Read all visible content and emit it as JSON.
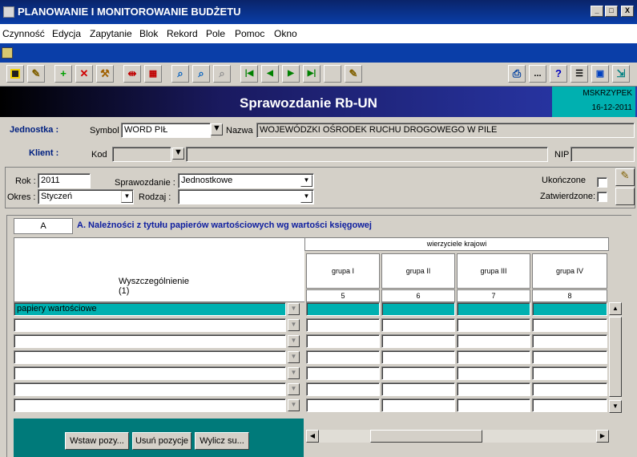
{
  "window": {
    "title": "PLANOWANIE I MONITOROWANIE BUDŻETU"
  },
  "window_buttons": [
    "_",
    "□",
    "X"
  ],
  "menu": [
    "Czynność",
    "Edycja",
    "Zapytanie",
    "Blok",
    "Rekord",
    "Pole",
    "Pomoc",
    "Okno"
  ],
  "toolbar": {
    "icons": [
      "save-icon",
      "edit-icon",
      "add-icon",
      "delete-icon",
      "tools-icon",
      "split-icon",
      "grid-icon",
      "search-icon",
      "query-icon",
      "clear-icon",
      "first-record-icon",
      "prev-record-icon",
      "next-record-icon",
      "last-record-icon",
      "blank-icon",
      "note-icon",
      "print-icon",
      "more-icon",
      "help-icon",
      "list-icon",
      "window-icon",
      "exit-icon"
    ],
    "more_label": "...",
    "help_label": "?"
  },
  "header": {
    "title": "Sprawozdanie Rb-UN",
    "user": "MSKRZYPEK",
    "date": "16-12-2011"
  },
  "jednostka": {
    "label": "Jednostka :",
    "symbol_label": "Symbol",
    "symbol_value": "WORD PIŁ",
    "nazwa_label": "Nazwa",
    "nazwa_value": "WOJEWÓDZKI OŚRODEK RUCHU DROGOWEGO W PILE"
  },
  "klient": {
    "label": "Klient :",
    "kod_label": "Kod",
    "kod_value": "",
    "name_value": "",
    "nip_label": "NIP",
    "nip_value": ""
  },
  "params": {
    "rok_label": "Rok :",
    "rok_value": "2011",
    "okres_label": "Okres :",
    "okres_value": "Styczeń",
    "sprawozdanie_label": "Sprawozdanie :",
    "sprawozdanie_value": "Jednostkowe",
    "rodzaj_label": "Rodzaj :",
    "rodzaj_value": "",
    "ukonczone_label": "Ukończone",
    "zatwierdzone_label": "Zatwierdzone:"
  },
  "section": {
    "tab": "A",
    "title": "A. Należności z tytułu papierów wartościowych wg wartości księgowej"
  },
  "table": {
    "group_header": "wierzyciele krajowi",
    "col1_header": "Wyszczególnienie",
    "col1_num": "(1)",
    "columns": [
      {
        "label": "grupa I",
        "num": "5"
      },
      {
        "label": "grupa II",
        "num": "6"
      },
      {
        "label": "grupa III",
        "num": "7"
      },
      {
        "label": "grupa IV",
        "num": "8"
      }
    ],
    "rows": [
      "papiery wartościowe",
      "",
      "",
      "",
      "",
      "",
      ""
    ]
  },
  "buttons": {
    "insert": "Wstaw pozy...",
    "remove": "Usuń pozycje",
    "calc": "Wylicz su..."
  },
  "colors": {
    "accent": "#00b0b0",
    "title_bar": "#0a246a",
    "header_gradient_end": "#2a3ab0",
    "bottom_panel": "#007a7a"
  }
}
